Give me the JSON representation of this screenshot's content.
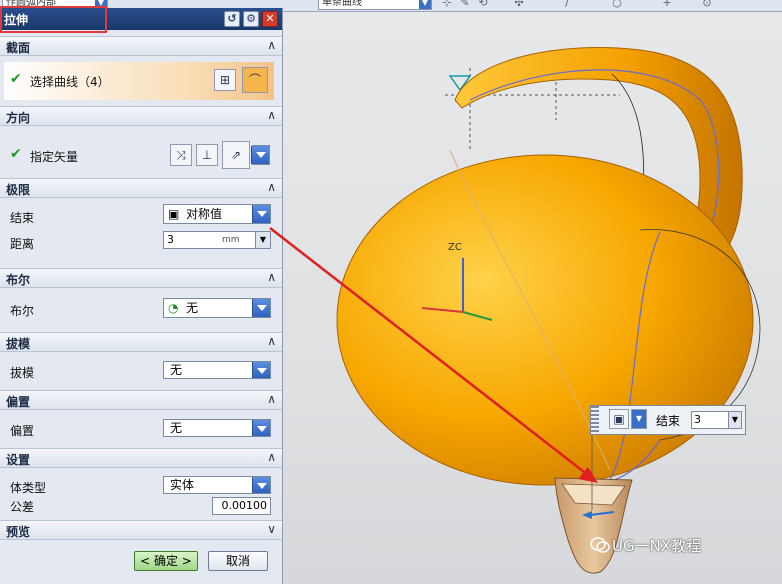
{
  "toolbar": {
    "combo_left": "作圆弧内部",
    "combo_center": "单条曲线",
    "icons": [
      "select-icon",
      "sketch-icon",
      "snap-icon",
      "arrow-icon",
      "curve-icon",
      "circle-icon",
      "plus-icon",
      "point-icon"
    ]
  },
  "dialog": {
    "title": "拉伸",
    "sections": {
      "section": {
        "header": "截面",
        "select_curve": "选择曲线（4）"
      },
      "direction": {
        "header": "方向",
        "specify_vector": "指定矢量"
      },
      "limits": {
        "header": "极限",
        "end_label": "结束",
        "end_value": "对称值",
        "distance_label": "距离",
        "distance_value": "3",
        "distance_unit": "mm"
      },
      "boolean": {
        "header": "布尔",
        "label": "布尔",
        "value": "无"
      },
      "draft": {
        "header": "拔模",
        "label": "拔模",
        "value": "无"
      },
      "offset": {
        "header": "偏置",
        "label": "偏置",
        "value": "无"
      },
      "settings": {
        "header": "设置",
        "body_type_label": "体类型",
        "body_type_value": "实体",
        "tolerance_label": "公差",
        "tolerance_value": "0.00100"
      },
      "preview": {
        "header": "预览"
      }
    },
    "ok_label": "< 确定 >",
    "cancel_label": "取消"
  },
  "viewport": {
    "axis_zc": "ZC",
    "handle_label": "结束",
    "handle_value": "3"
  },
  "watermark": "UG一NX教程",
  "colors": {
    "model": "#f7a700",
    "title_bar": "#1f3f78",
    "annotation": "#e02020",
    "ok_button": "#9fd68a"
  }
}
